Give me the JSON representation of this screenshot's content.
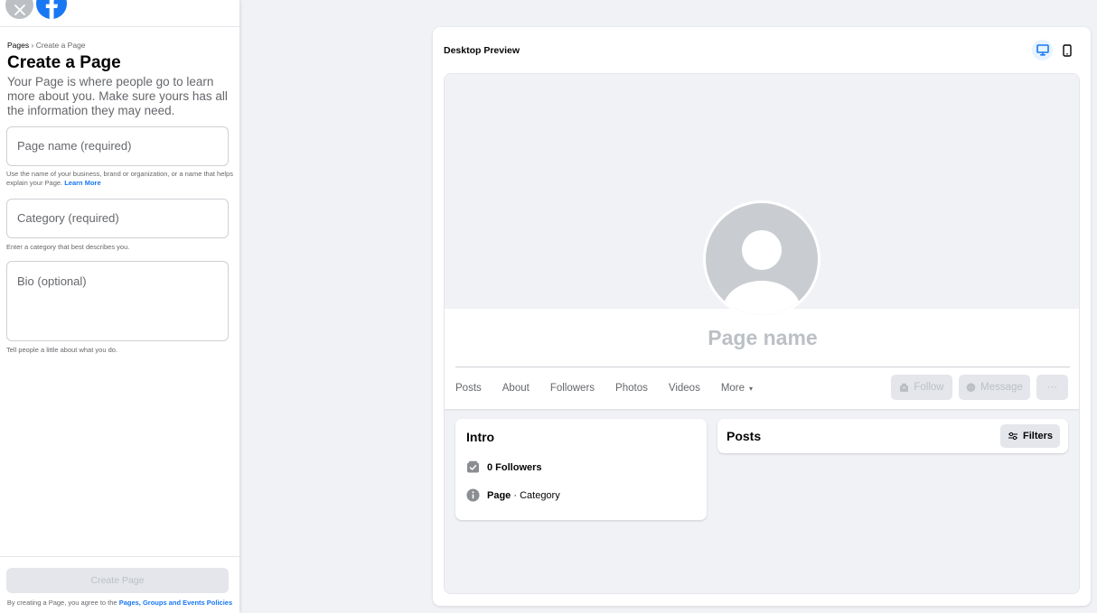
{
  "sidebar": {
    "breadcrumb": {
      "parent": "Pages",
      "separator": "›",
      "current": "Create a Page"
    },
    "title": "Create a Page",
    "description": "Your Page is where people go to learn more about you. Make sure yours has all the information they may need.",
    "fields": {
      "page_name": {
        "placeholder": "Page name (required)",
        "hint": "Use the name of your business, brand or organization, or a name that helps explain your Page.",
        "hint_link": "Learn More"
      },
      "category": {
        "placeholder": "Category (required)",
        "hint": "Enter a category that best describes you."
      },
      "bio": {
        "placeholder": "Bio (optional)",
        "hint": "Tell people a little about what you do."
      }
    },
    "create_button": "Create Page",
    "agreement": {
      "text": "By creating a Page, you agree to the",
      "link": "Pages, Groups and Events Policies"
    }
  },
  "preview": {
    "title": "Desktop Preview",
    "page_name": "Page name",
    "tabs": [
      "Posts",
      "About",
      "Followers",
      "Photos",
      "Videos",
      "More"
    ],
    "more_caret": "▾",
    "buttons": {
      "follow": "Follow",
      "message": "Message",
      "more": "···"
    },
    "intro": {
      "title": "Intro",
      "followers": "0 Followers",
      "page_label": "Page",
      "separator": " · ",
      "category": "Category"
    },
    "posts": {
      "title": "Posts",
      "filters": "Filters"
    }
  },
  "colors": {
    "accent": "#1877f2",
    "background": "#f0f2f5",
    "disabled": "#bcc0c4",
    "muted_text": "#65676b"
  },
  "icons": {
    "close": "close-icon",
    "logo": "facebook-logo-icon",
    "desktop": "desktop-icon",
    "mobile": "mobile-icon",
    "followers": "followers-icon",
    "info": "info-icon",
    "filters": "filters-icon"
  }
}
